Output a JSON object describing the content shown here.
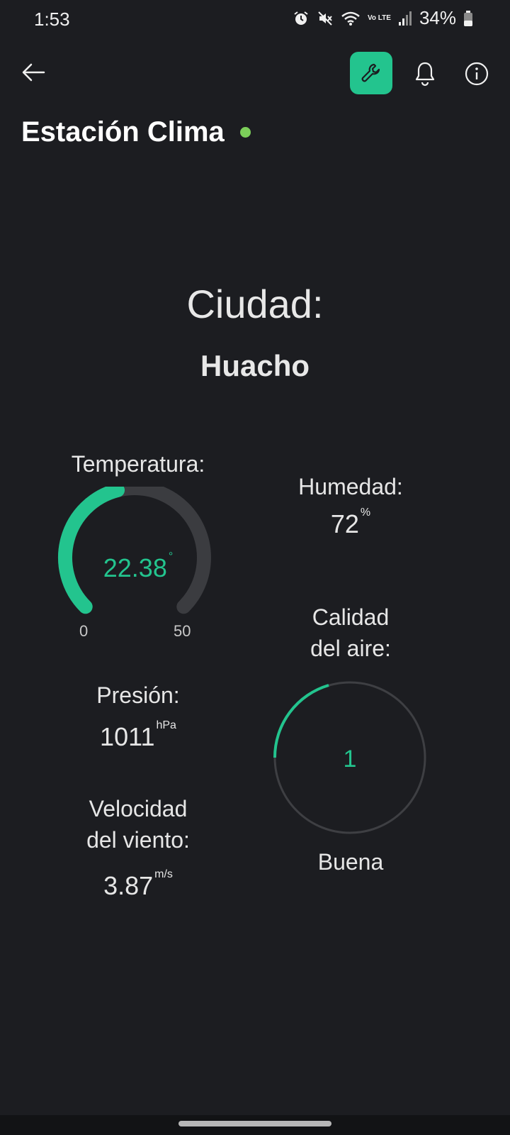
{
  "status_bar": {
    "time": "1:53",
    "network": "Vo LTE",
    "battery": "34%"
  },
  "header": {
    "title": "Estación Clima",
    "online_color": "#7ccf5a",
    "accent_color": "#23c48e"
  },
  "city": {
    "label": "Ciudad:",
    "value": "Huacho"
  },
  "temperature": {
    "label": "Temperatura:",
    "value": "22.38",
    "unit": "°",
    "min": "0",
    "max": "50",
    "fraction": 0.4476
  },
  "humidity": {
    "label": "Humedad:",
    "value": "72",
    "unit": "%"
  },
  "air_quality": {
    "label_line1": "Calidad",
    "label_line2": "del aire:",
    "value": "1",
    "status": "Buena"
  },
  "pressure": {
    "label": "Presión:",
    "value": "1011",
    "unit": "hPa"
  },
  "wind": {
    "label_line1": "Velocidad",
    "label_line2": "del viento:",
    "value": "3.87",
    "unit": "m/s"
  }
}
